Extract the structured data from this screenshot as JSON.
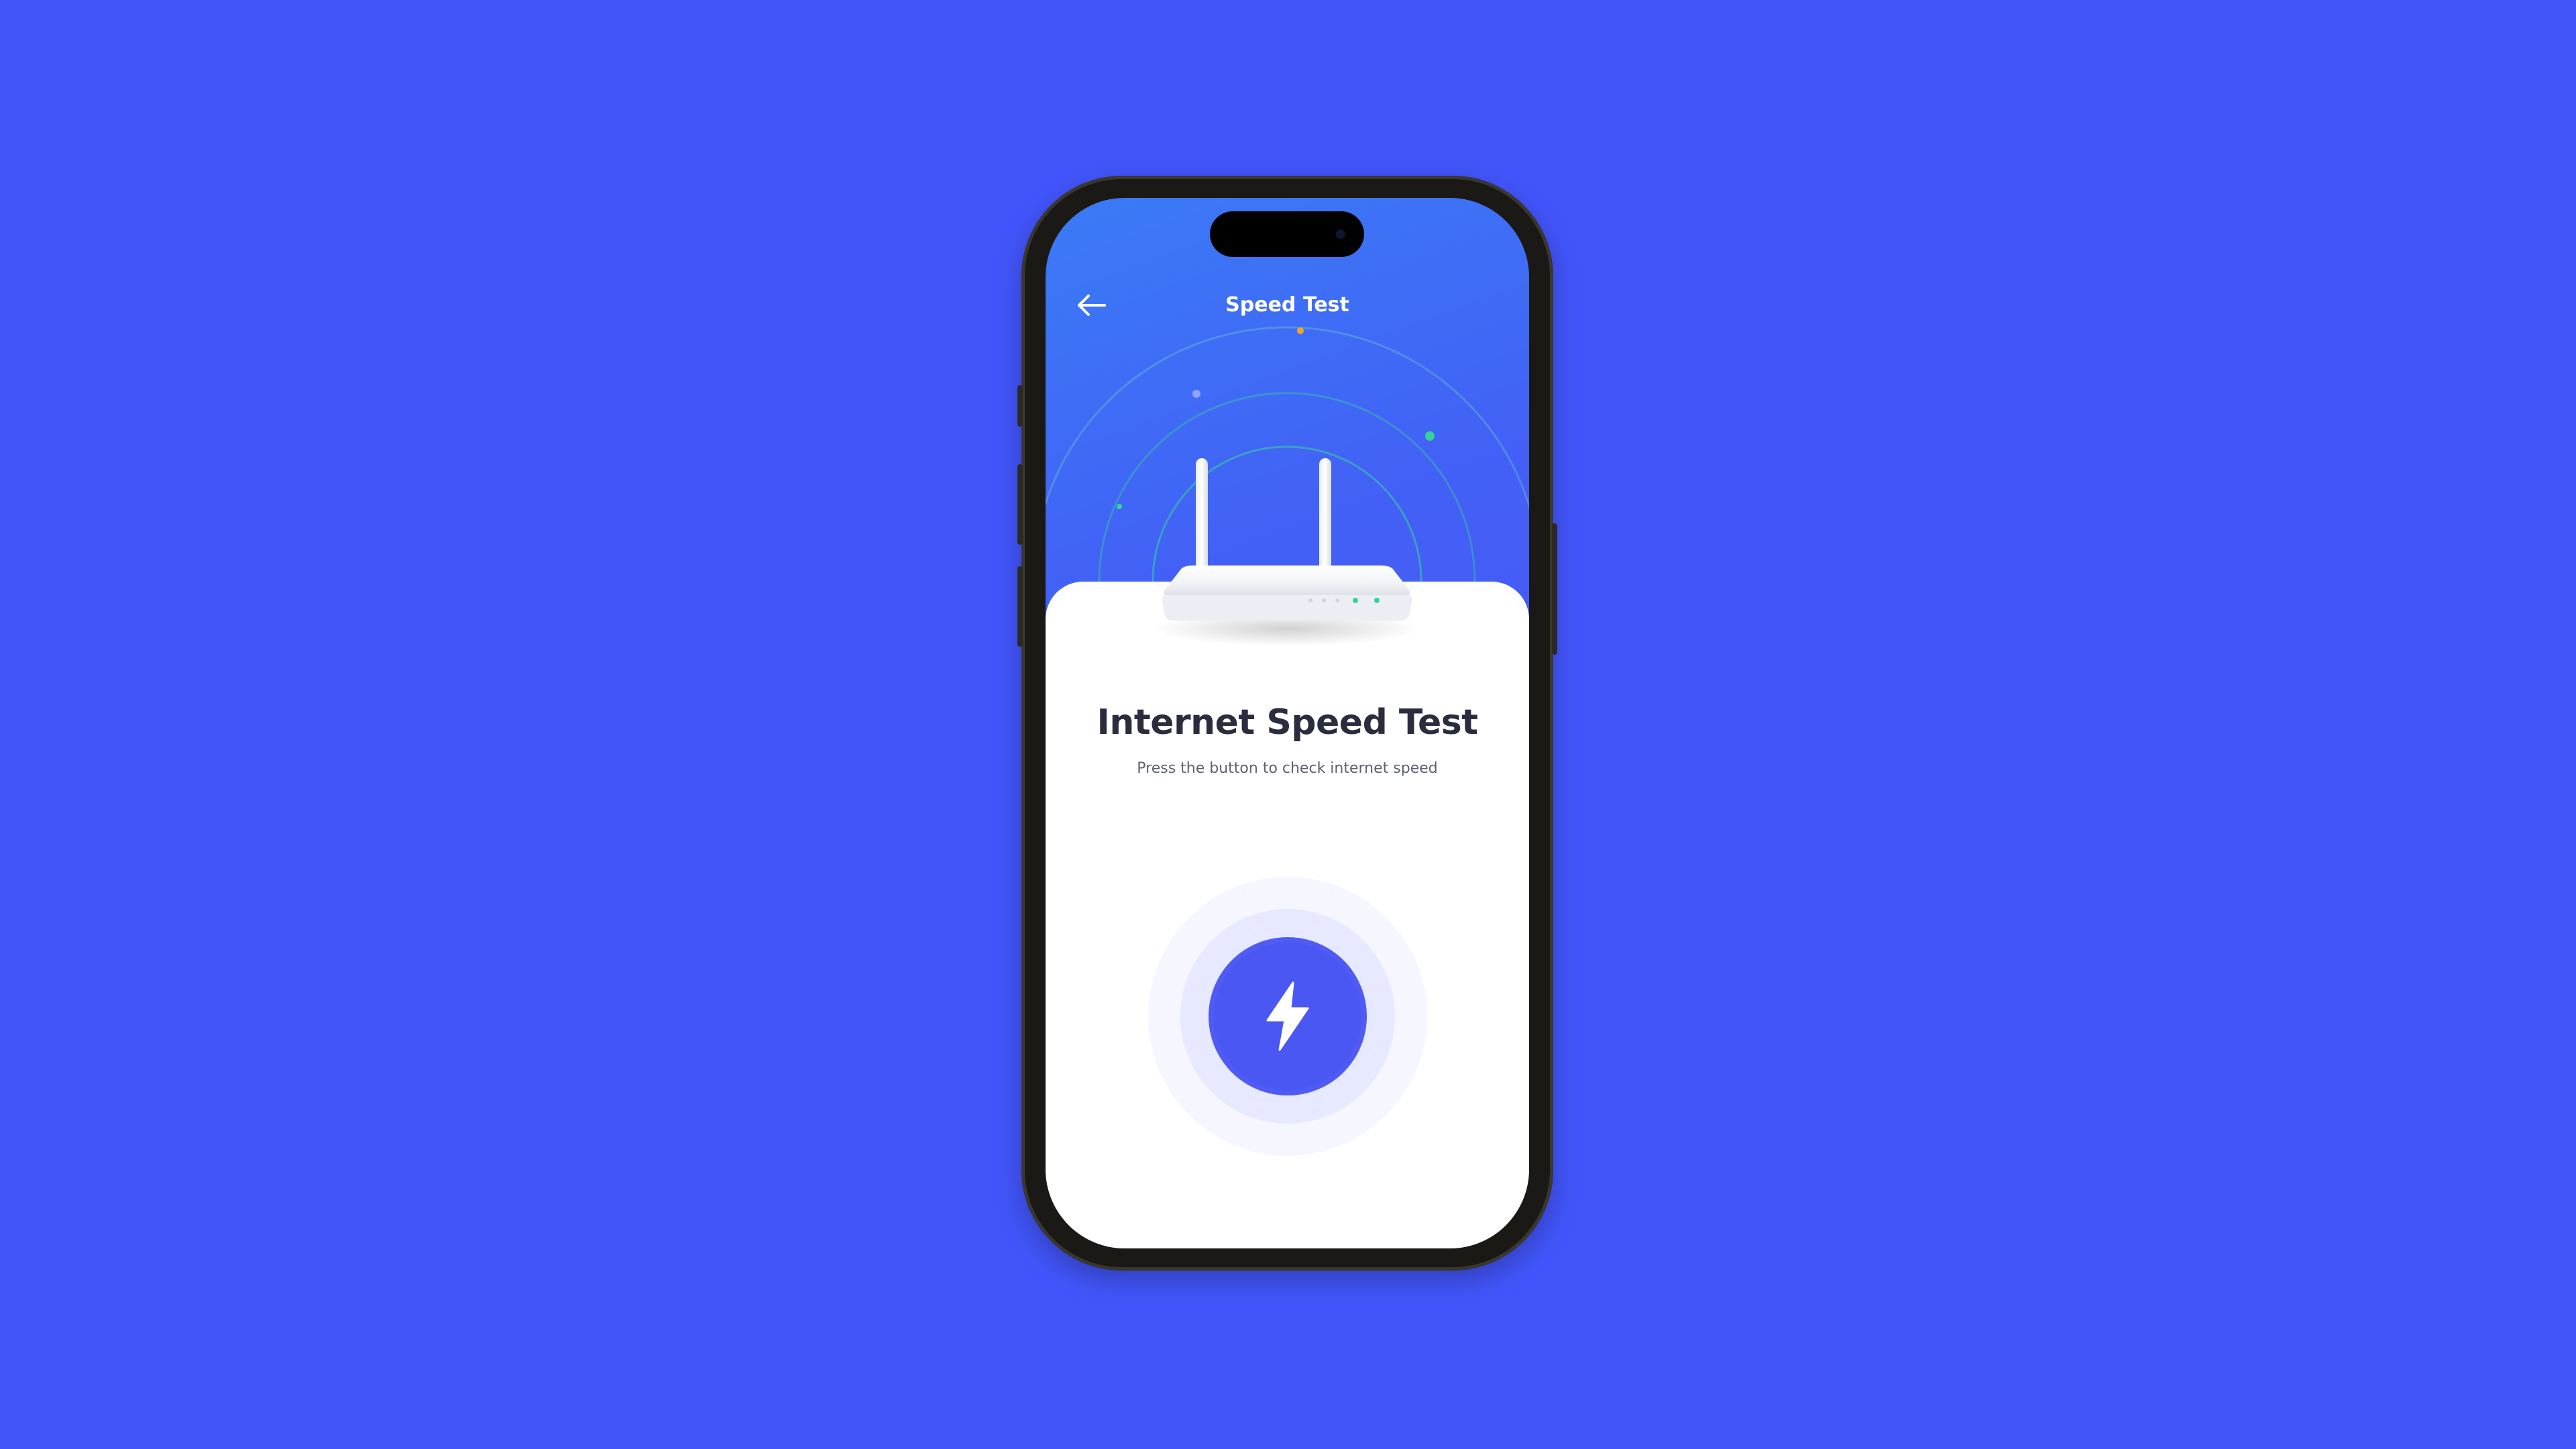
{
  "header": {
    "title": "Speed Test",
    "back_icon": "arrow-left-icon"
  },
  "main": {
    "heading": "Internet Speed Test",
    "subheading": "Press the button to check internet speed",
    "start_icon": "lightning-bolt-icon"
  },
  "colors": {
    "background": "#4255FA",
    "header_gradient_start": "#3A7BF6",
    "header_gradient_end": "#4A4CF5",
    "accent": "#4A57F3",
    "signal_green": "#34D399",
    "signal_orange": "#F5A623",
    "heading_text": "#2A2D3D"
  }
}
